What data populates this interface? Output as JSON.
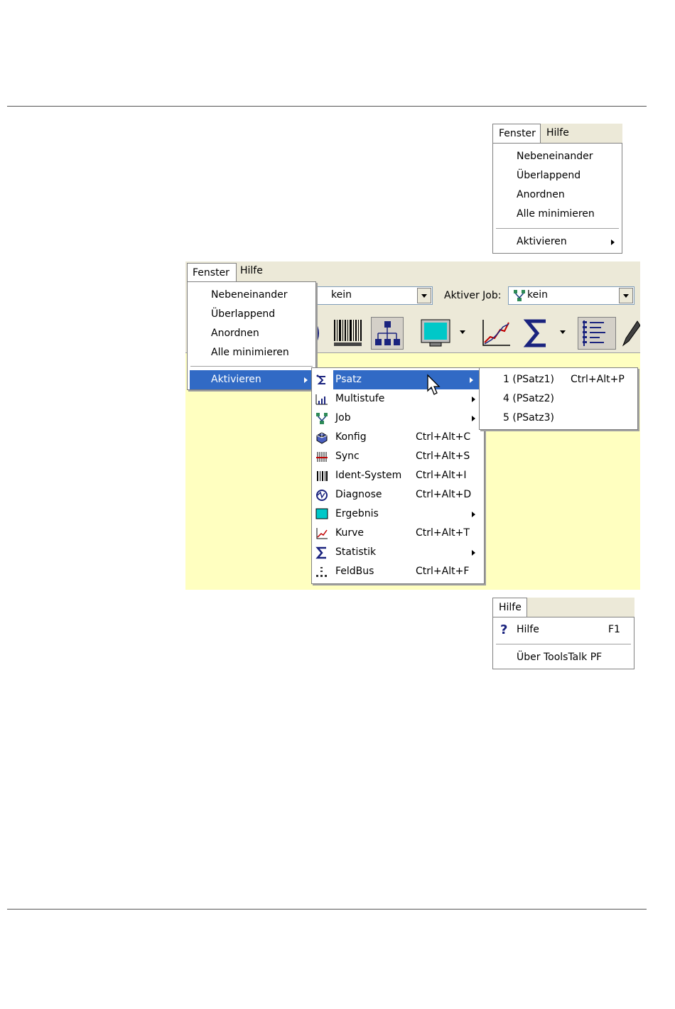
{
  "window_menu_top": {
    "menubar": [
      "Fenster",
      "Hilfe"
    ],
    "items": [
      "Nebeneinander",
      "Überlappend",
      "Anordnen",
      "Alle minimieren"
    ],
    "activate": "Aktivieren"
  },
  "main": {
    "menubar": [
      "Fenster",
      "Hilfe"
    ],
    "items": [
      "Nebeneinander",
      "Überlappend",
      "Anordnen",
      "Alle minimieren"
    ],
    "activate": "Aktivieren",
    "combo1_value": "kein",
    "active_job_label": "Aktiver Job:",
    "combo2_value": "kein",
    "toolbar_icons": [
      "statistic-icon",
      "barcode-icon",
      "hierarchy-icon",
      "monitor-icon",
      "curve-icon",
      "sigma-icon",
      "fieldbus-list-icon",
      "pen-icon"
    ],
    "activate_submenu": [
      {
        "label": "Psatz",
        "shortcut": "",
        "submenu": true,
        "icon": "psatz-icon"
      },
      {
        "label": "Multistufe",
        "shortcut": "",
        "submenu": true,
        "icon": "multistufe-icon"
      },
      {
        "label": "Job",
        "shortcut": "",
        "submenu": true,
        "icon": "job-icon"
      },
      {
        "label": "Konfig",
        "shortcut": "Ctrl+Alt+C",
        "submenu": false,
        "icon": "konfig-icon"
      },
      {
        "label": "Sync",
        "shortcut": "Ctrl+Alt+S",
        "submenu": false,
        "icon": "sync-icon"
      },
      {
        "label": "Ident-System",
        "shortcut": "Ctrl+Alt+I",
        "submenu": false,
        "icon": "barcode-icon"
      },
      {
        "label": "Diagnose",
        "shortcut": "Ctrl+Alt+D",
        "submenu": false,
        "icon": "diagnose-icon"
      },
      {
        "label": "Ergebnis",
        "shortcut": "",
        "submenu": true,
        "icon": "monitor-icon"
      },
      {
        "label": "Kurve",
        "shortcut": "Ctrl+Alt+T",
        "submenu": false,
        "icon": "curve-icon"
      },
      {
        "label": "Statistik",
        "shortcut": "",
        "submenu": true,
        "icon": "sigma-icon"
      },
      {
        "label": "FeldBus",
        "shortcut": "Ctrl+Alt+F",
        "submenu": false,
        "icon": "fieldbus-icon"
      }
    ],
    "psatz_submenu": [
      {
        "label": "1 (PSatz1)",
        "shortcut": "Ctrl+Alt+P"
      },
      {
        "label": "4 (PSatz2)",
        "shortcut": ""
      },
      {
        "label": "5 (PSatz3)",
        "shortcut": ""
      }
    ]
  },
  "help_menu": {
    "menubar": "Hilfe",
    "item": "Hilfe",
    "item_shortcut": "F1",
    "about": "Über ToolsTalk PF"
  }
}
